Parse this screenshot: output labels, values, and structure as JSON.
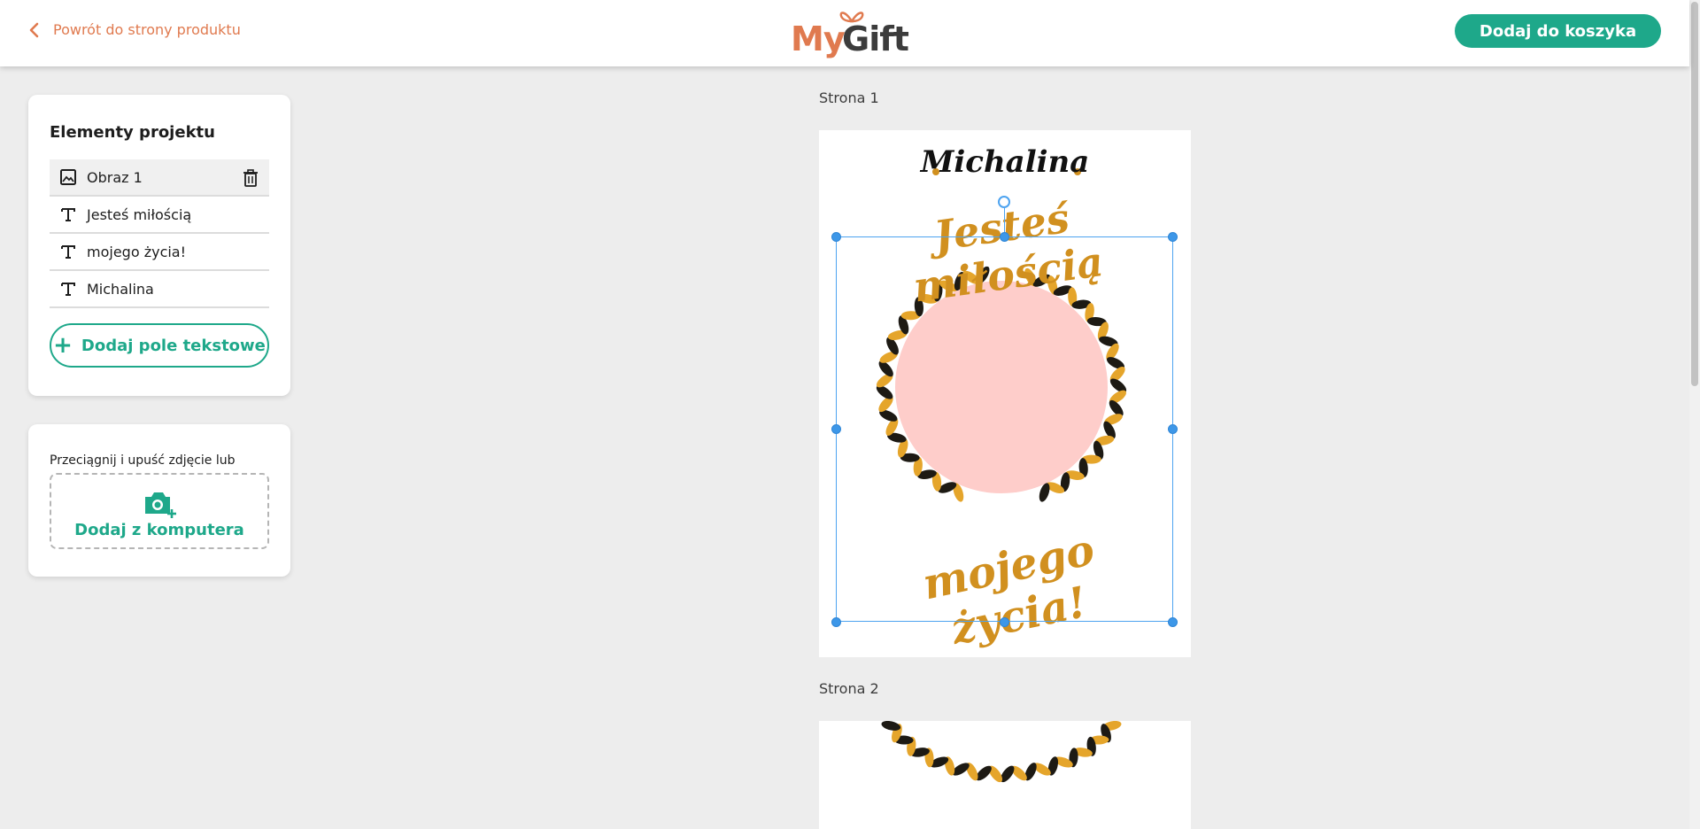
{
  "header": {
    "back_label": "Powrót do strony produktu",
    "logo_my": "My",
    "logo_gift": "Gift",
    "cart_label": "Dodaj do koszyka"
  },
  "elements_panel": {
    "title": "Elementy projektu",
    "items": [
      {
        "label": "Obraz 1",
        "type": "image-icon"
      },
      {
        "label": "Jesteś miłością",
        "type": "text-icon"
      },
      {
        "label": "mojego życia!",
        "type": "text-icon"
      },
      {
        "label": "Michalina",
        "type": "text-icon"
      }
    ],
    "add_text_label": "Dodaj pole tekstowe"
  },
  "upload_panel": {
    "hint": "Przeciągnij i upuść zdjęcie lub",
    "button_label": "Dodaj z komputera"
  },
  "canvas": {
    "page1_label": "Strona 1",
    "page2_label": "Strona 2",
    "name_text": "Michalina",
    "line1_text": "Jesteś miłością",
    "line2_text": "mojego życia!"
  },
  "colors": {
    "accent_green": "#1ea88a",
    "accent_orange": "#e07a4f",
    "gold": "#d1901f",
    "selection_blue": "#4da3f0",
    "circle_pink": "#fecdca"
  }
}
